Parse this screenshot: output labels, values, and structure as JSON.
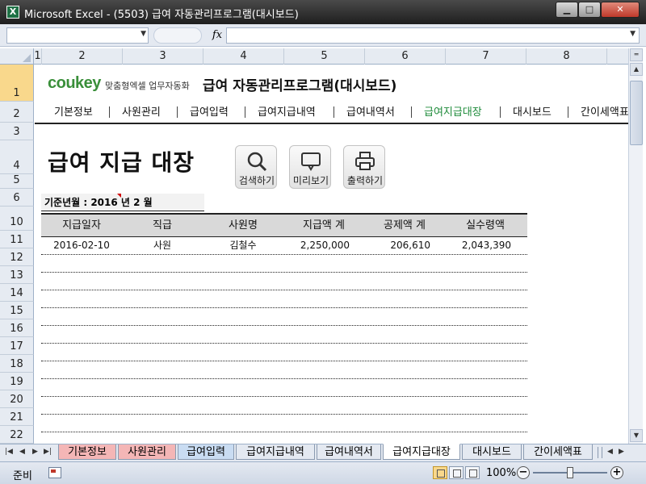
{
  "window": {
    "title": "Microsoft Excel - (5503) 급여 자동관리프로그램(대시보드)",
    "app_icon": "excel-icon"
  },
  "formula_bar": {
    "name_box": "",
    "fx_label": "fx",
    "formula": ""
  },
  "columns": [
    "1",
    "2",
    "3",
    "4",
    "5",
    "6",
    "7",
    "8"
  ],
  "rows": [
    "1",
    "2",
    "3",
    "4",
    "5",
    "6",
    "10",
    "11",
    "12",
    "13",
    "14",
    "15",
    "16",
    "17",
    "18",
    "19",
    "20",
    "21",
    "22"
  ],
  "selected_row": "1",
  "header": {
    "logo": "coukey",
    "logo_sub": "맞춤형엑셀 업무자동화",
    "app_title": "급여 자동관리프로그램(대시보드)"
  },
  "nav": {
    "items": [
      "기본정보",
      "사원관리",
      "급여입력",
      "급여지급내역",
      "급여내역서",
      "급여지급대장",
      "대시보드",
      "간이세액표"
    ],
    "active": "급여지급대장"
  },
  "page": {
    "title": "급여 지급 대장",
    "buttons": {
      "search": "검색하기",
      "preview": "미리보기",
      "print": "출력하기"
    },
    "basis": "기준년월 : 2016 년  2 월"
  },
  "table": {
    "headers": [
      "지급일자",
      "직급",
      "사원명",
      "지급액 계",
      "공제액 계",
      "실수령액"
    ],
    "rows": [
      [
        "2016-02-10",
        "사원",
        "김철수",
        "2,250,000",
        "206,610",
        "2,043,390"
      ]
    ],
    "empty_rows": 10
  },
  "sheet_tabs": [
    {
      "label": "기본정보",
      "color": "red"
    },
    {
      "label": "사원관리",
      "color": "red"
    },
    {
      "label": "급여입력",
      "color": "blue"
    },
    {
      "label": "급여지급내역",
      "color": "plain"
    },
    {
      "label": "급여내역서",
      "color": "plain"
    },
    {
      "label": "급여지급대장",
      "color": "plain",
      "active": true
    },
    {
      "label": "대시보드",
      "color": "plain"
    },
    {
      "label": "간이세액표",
      "color": "plain"
    }
  ],
  "status": {
    "mode": "준비",
    "zoom": "100%"
  },
  "colors": {
    "accent_green": "#1e8b3a",
    "header_fill": "#d9d9d9",
    "tab_red": "#f4b6b6",
    "tab_blue": "#c9dcf2"
  }
}
